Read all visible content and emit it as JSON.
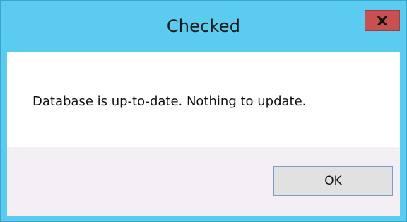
{
  "dialog": {
    "title": "Checked",
    "message": "Database is up-to-date. Nothing to update.",
    "ok_label": "OK",
    "close_icon": "close-icon"
  },
  "colors": {
    "titlebar": "#5ccbf0",
    "close_button": "#c75050",
    "content_bg": "#ffffff",
    "footer_bg": "#f3eef4",
    "button_bg": "#e1e1e1",
    "button_border": "#7a9ec7"
  }
}
